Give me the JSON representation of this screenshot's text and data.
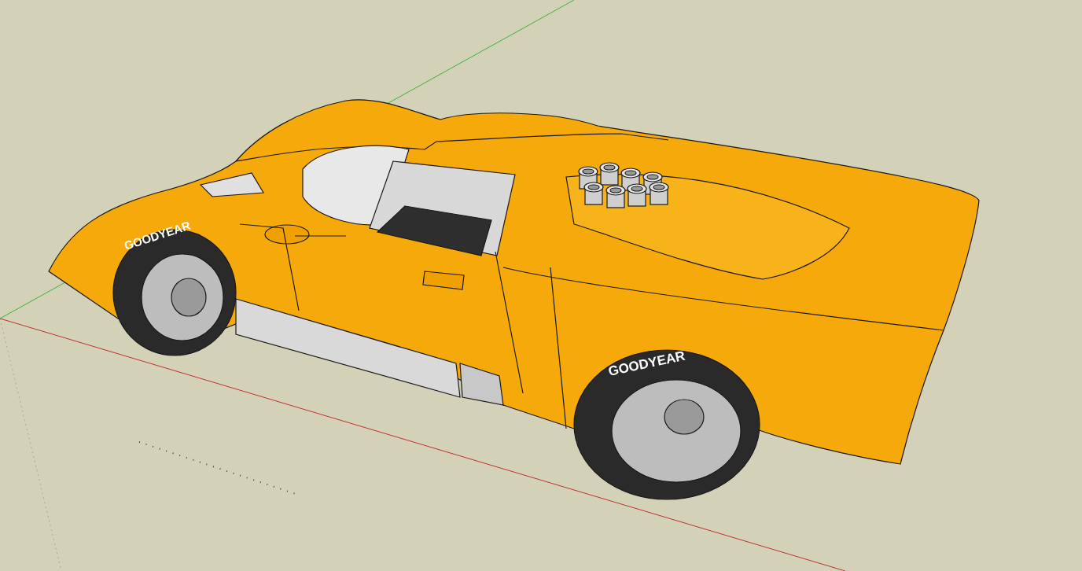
{
  "viewport": {
    "tire_lettering": [
      "GOODYEAR",
      "GOODYEAR"
    ]
  }
}
